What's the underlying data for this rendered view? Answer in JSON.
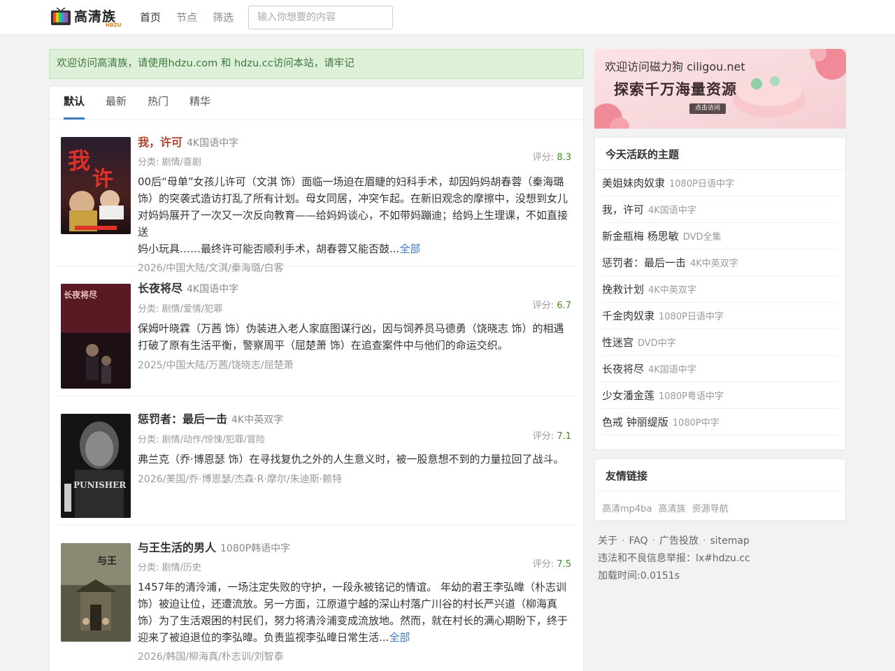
{
  "site": {
    "logo_text": "高清族",
    "logo_sub": "HDZU"
  },
  "nav": [
    {
      "label": "首页",
      "active": true
    },
    {
      "label": "节点",
      "active": false
    },
    {
      "label": "筛选",
      "active": false
    }
  ],
  "search": {
    "placeholder": "输入你想要的内容"
  },
  "notice": "欢迎访问高清族，请使用hdzu.com 和 hdzu.cc访问本站，请牢记",
  "tabs": [
    {
      "label": "默认",
      "active": true
    },
    {
      "label": "最新",
      "active": false
    },
    {
      "label": "热门",
      "active": false
    },
    {
      "label": "精华",
      "active": false
    }
  ],
  "labels": {
    "category": "分类:",
    "rating": "评分:",
    "more": "全部"
  },
  "items": [
    {
      "title": "我，许可",
      "quality": "4K国语中字",
      "category": "剧情/喜剧",
      "rating": "8.3",
      "desc_lines": [
        "00后“母单”女孩儿许可（文淇 饰）面临一场迫在眉睫的妇科手术，却因妈妈胡春蓉（秦海璐",
        "饰）的突袭式造访打乱了所有计划。母女同居，冲突乍起。在新旧观念的摩擦中，没想到女儿",
        "对妈妈展开了一次又一次反向教育——给妈妈谈心，不如带妈蹦迪；给妈上生理课，不如直接送",
        "妈小玩具……最终许可能否顺利手术，胡春蓉又能否鼓..."
      ],
      "has_more": true,
      "meta": "2026/中国大陆/文淇/秦海璐/白客",
      "poster_colors": [
        "#3a1a1a",
        "#c0392b"
      ]
    },
    {
      "title": "长夜将尽",
      "quality": "4K国语中字",
      "category": "剧情/爱情/犯罪",
      "rating": "6.7",
      "desc_lines": [
        "保姆叶晓霖（万茜 饰）伪装进入老人家庭图谋行凶，因与饲养员马德勇（饶晓志 饰）的相遇",
        "打破了原有生活平衡，警察周平（屈楚萧 饰）在追查案件中与他们的命运交织。"
      ],
      "has_more": false,
      "meta": "2025/中国大陆/万茜/饶晓志/屈楚萧",
      "poster_colors": [
        "#1a0f12",
        "#6b1f2a"
      ]
    },
    {
      "title": "惩罚者：最后一击",
      "quality": "4K中英双字",
      "category": "剧情/动作/惊悚/犯罪/冒险",
      "rating": "7.1",
      "desc_lines": [
        "弗兰克（乔·博恩瑟 饰）在寻找复仇之外的人生意义时，被一股意想不到的力量拉回了战斗。"
      ],
      "has_more": false,
      "meta": "2026/美国/乔·博恩瑟/杰森·R·摩尔/朱迪斯·赖特",
      "poster_colors": [
        "#111111",
        "#444444"
      ]
    },
    {
      "title": "与王生活的男人",
      "quality": "1080P韩语中字",
      "category": "剧情/历史",
      "rating": "7.5",
      "desc_lines": [
        "1457年的清泠浦，一场注定失败的守护，一段永被铭记的情谊。 年幼的君王李弘暐（朴志训",
        "饰）被迫让位，还遭流放。另一方面，江原道宁越的深山村落广川谷的村长严兴道（柳海真",
        "饰）为了生活艰困的村民们，努力将清泠浦变成流放地。然而，就在村长的满心期盼下，终于",
        "迎来了被迫退位的李弘暐。负责监视李弘暐日常生活..."
      ],
      "has_more": true,
      "meta": "2026/韩国/柳海真/朴志训/刘智泰",
      "poster_colors": [
        "#7b7b66",
        "#3d3b2c"
      ]
    }
  ],
  "banner": {
    "line1": "欢迎访问磁力狗 ciligou.net",
    "line2": "探索千万海量资源",
    "button": "点击访问"
  },
  "active_topics": {
    "title": "今天活跃的主题",
    "items": [
      {
        "name": "美姐妹肉奴隶",
        "quality": "1080P日语中字"
      },
      {
        "name": "我，许可",
        "quality": "4K国语中字"
      },
      {
        "name": "新金瓶梅 杨思敏",
        "quality": "DVD全集"
      },
      {
        "name": "惩罚者：最后一击",
        "quality": "4K中英双字"
      },
      {
        "name": "挽救计划",
        "quality": "4K中英双字"
      },
      {
        "name": "千金肉奴隶",
        "quality": "1080P日语中字"
      },
      {
        "name": "性迷宫",
        "quality": "DVD中字"
      },
      {
        "name": "长夜将尽",
        "quality": "4K国语中字"
      },
      {
        "name": "少女潘金莲",
        "quality": "1080P粤语中字"
      },
      {
        "name": "色戒 钟丽缇版",
        "quality": "1080P中字"
      }
    ]
  },
  "friend_links": {
    "title": "友情链接",
    "items": [
      "高清mp4ba",
      "高清族",
      "资源导航"
    ]
  },
  "footer": {
    "links": [
      "关于",
      "FAQ",
      "广告投放",
      "sitemap"
    ],
    "report": "违法和不良信息举报：lx#hdzu.cc",
    "load_time": "加载时间:0.0151s"
  }
}
